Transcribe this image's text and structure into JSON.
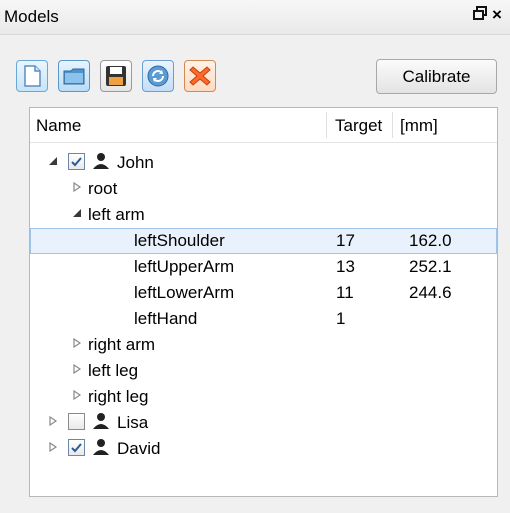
{
  "panel": {
    "title": "Models",
    "float_icon": "restore-icon",
    "close_icon": "close-icon",
    "close_label": "×",
    "float_label": "🗗"
  },
  "toolbar": {
    "buttons": [
      {
        "name": "new-file-icon"
      },
      {
        "name": "open-folder-icon"
      },
      {
        "name": "save-disk-icon"
      },
      {
        "name": "refresh-icon"
      },
      {
        "name": "delete-icon"
      }
    ],
    "calibrate_label": "Calibrate"
  },
  "tree": {
    "columns": [
      "Name",
      "Target",
      "[mm]"
    ],
    "rows": {
      "john": {
        "label": "John",
        "checked": true
      },
      "root": {
        "label": "root"
      },
      "left_arm": {
        "label": "left arm"
      },
      "left_shoulder": {
        "label": "leftShoulder",
        "target": "17",
        "mm": "162.0",
        "selected": true
      },
      "left_upper_arm": {
        "label": "leftUpperArm",
        "target": "13",
        "mm": "252.1"
      },
      "left_lower_arm": {
        "label": "leftLowerArm",
        "target": "11",
        "mm": "244.6"
      },
      "left_hand": {
        "label": "leftHand",
        "target": "1",
        "mm": ""
      },
      "right_arm": {
        "label": "right arm"
      },
      "left_leg": {
        "label": "left leg"
      },
      "right_leg": {
        "label": "right leg"
      },
      "lisa": {
        "label": "Lisa",
        "checked": false
      },
      "david": {
        "label": "David",
        "checked": true
      }
    }
  },
  "colors": {
    "selection_bg": "#e9f2fc",
    "selection_border": "#9fc4ea",
    "check_mark": "#2a5a9a"
  }
}
